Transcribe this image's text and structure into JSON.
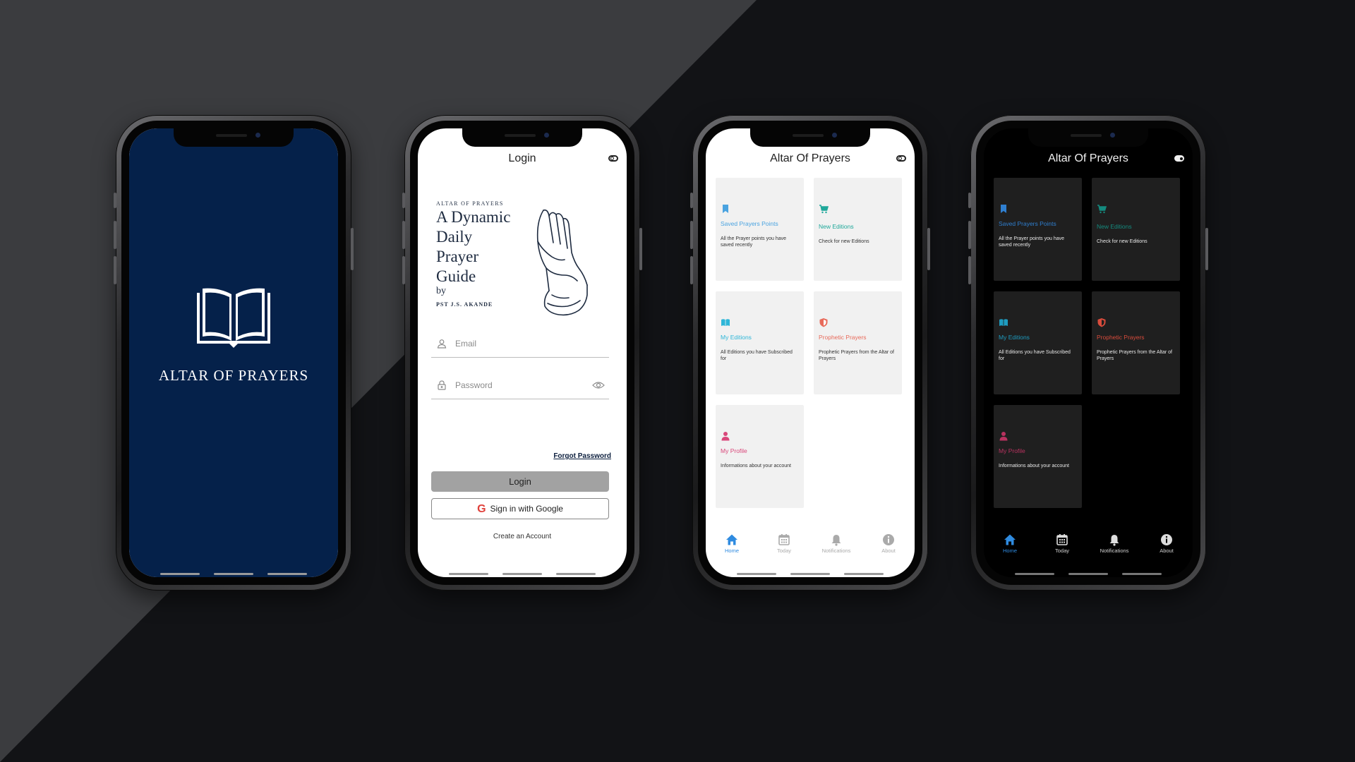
{
  "splash": {
    "title": "ALTAR OF PRAYERS",
    "background": "#05214a",
    "logo_icon": "open-book-icon"
  },
  "login": {
    "header": "Login",
    "brand_small": "ALTAR OF PRAYERS",
    "brand_lines": [
      "A Dynamic",
      "Daily",
      "Prayer",
      "Guide"
    ],
    "brand_by": "by",
    "brand_author": "PST J.S. AKANDE",
    "email_placeholder": "Email",
    "password_placeholder": "Password",
    "forgot_password": "Forgot Password",
    "login_button": "Login",
    "google_button": "Sign in with Google",
    "create_account": "Create an Account"
  },
  "home": {
    "header": "Altar Of Prayers",
    "cards": [
      {
        "title": "Saved Prayers Points",
        "desc": "All the Prayer points you have saved recently",
        "color": "#4aa3e0",
        "icon": "bookmark-icon"
      },
      {
        "title": "New Editions",
        "desc": "Check for new Editions",
        "color": "#1fa89a",
        "icon": "cart-icon"
      },
      {
        "title": "My Editions",
        "desc": "All Editions you have Subscribed for",
        "color": "#2eb6d8",
        "icon": "book-icon"
      },
      {
        "title": "Prophetic Prayers",
        "desc": "Prophetic Prayers from the Altar of Prayers",
        "color": "#e86a5a",
        "icon": "shield-icon"
      },
      {
        "title": "My Profile",
        "desc": "Informations about your account",
        "color": "#d9477a",
        "icon": "person-icon"
      }
    ],
    "tabs": [
      {
        "label": "Home",
        "icon": "home-icon"
      },
      {
        "label": "Today",
        "icon": "calendar-icon"
      },
      {
        "label": "Notifications",
        "icon": "bell-icon"
      },
      {
        "label": "About",
        "icon": "info-icon"
      }
    ],
    "active_tab": "Home"
  },
  "colors": {
    "accent": "#2f8be0",
    "navy": "#05214a"
  }
}
